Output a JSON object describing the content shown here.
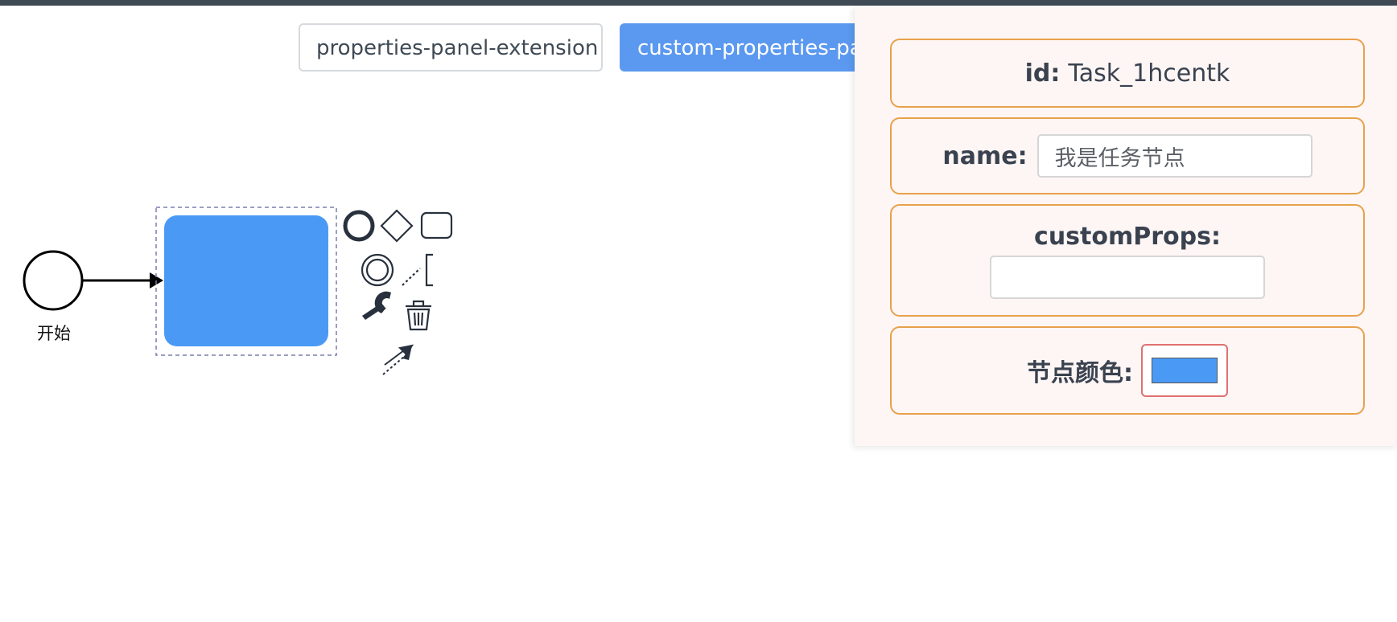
{
  "tabs": [
    {
      "label": "properties-panel-extension",
      "active": false
    },
    {
      "label": "custom-properties-pa",
      "active": true
    }
  ],
  "canvas": {
    "start_event_label": "开始",
    "task_color": "#4a9af5",
    "context_pad_icons": [
      "start-event-icon",
      "gateway-icon",
      "task-icon",
      "intermediate-event-icon",
      "text-annotation-icon",
      "change-type-wrench-icon",
      "delete-trash-icon",
      "connect-arrow-icon"
    ]
  },
  "panel": {
    "id": {
      "label": "id:",
      "value": "Task_1hcentk"
    },
    "name": {
      "label": "name:",
      "value": "我是任务节点"
    },
    "custom_props": {
      "label": "customProps:",
      "value": ""
    },
    "node_color": {
      "label": "节点颜色:",
      "value": "#4a9af5"
    }
  }
}
